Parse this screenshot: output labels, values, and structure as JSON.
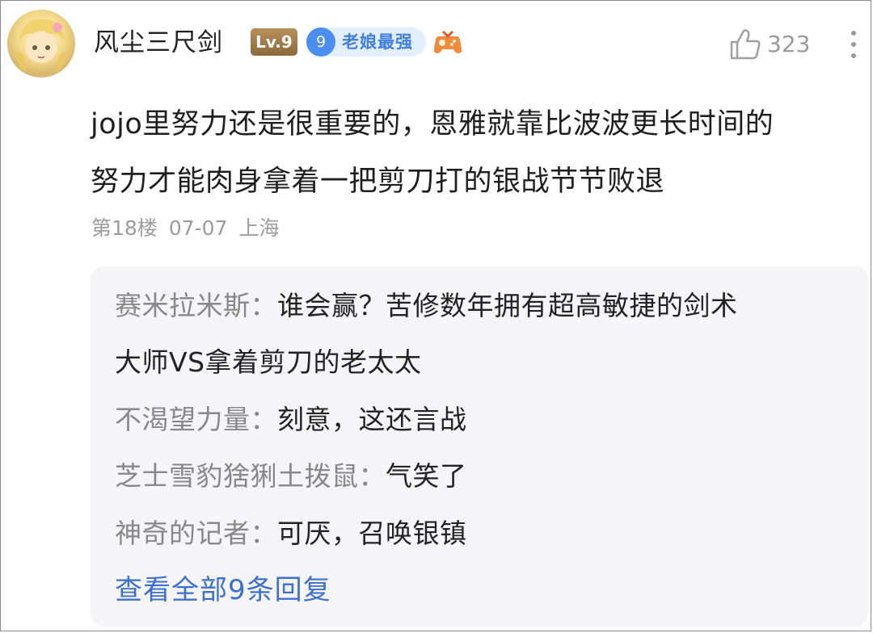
{
  "comment": {
    "username": "风尘三尺剑",
    "level_badge": "Lv.9",
    "fan_badge": {
      "level": "9",
      "name": "老娘最强"
    },
    "likes": "323",
    "content_lines": [
      "jojo里努力还是很重要的，恩雅就靠比波波更长时间的",
      "努力才能肉身拿着一把剪刀打的银战节节败退"
    ],
    "floor": "第18楼",
    "date": "07-07",
    "location": "上海"
  },
  "replies": [
    {
      "author": "赛米拉米斯：",
      "lines": [
        "谁会赢？苦修数年拥有超高敏捷的剑术",
        "大师VS拿着剪刀的老太太"
      ]
    },
    {
      "author": "不渴望力量：",
      "lines": [
        "刻意，这还言战"
      ]
    },
    {
      "author": "芝士雪豹猞猁土拨鼠：",
      "lines": [
        "气笑了"
      ]
    },
    {
      "author": "神奇的记者：",
      "lines": [
        "可厌，召唤银镇"
      ]
    }
  ],
  "view_all_label": "查看全部9条回复",
  "icons": {
    "avatar": "user-avatar",
    "game": "gamepad-icon",
    "like": "thumbs-up-icon",
    "more": "more-vertical-icon"
  },
  "colors": {
    "link": "#3d6fcf",
    "fan_badge_bg": "#e3efff",
    "level_badge": "#a07a48",
    "reply_bg": "#f5f5f7"
  }
}
